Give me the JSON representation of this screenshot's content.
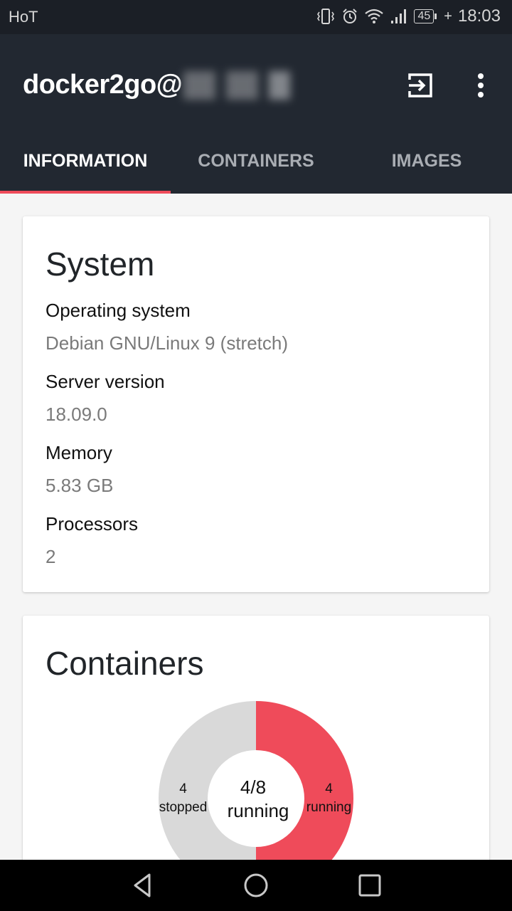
{
  "status_bar": {
    "carrier": "HoT",
    "battery": "45",
    "time": "18:03",
    "icons": [
      "vibrate-icon",
      "alarm-icon",
      "wifi-icon",
      "signal-icon",
      "battery-icon",
      "charging-icon"
    ]
  },
  "app_bar": {
    "title_prefix": "docker2go@",
    "title_host_redacted": true,
    "actions": [
      {
        "name": "logout-icon"
      },
      {
        "name": "more-options-icon"
      }
    ]
  },
  "tabs": [
    {
      "label": "INFORMATION",
      "active": true
    },
    {
      "label": "CONTAINERS",
      "active": false
    },
    {
      "label": "IMAGES",
      "active": false
    }
  ],
  "colors": {
    "accent": "#ef4b5a",
    "appbar": "#222831",
    "statusbar": "#1b1f26",
    "stopped": "#d9d9d9"
  },
  "system": {
    "title": "System",
    "fields": [
      {
        "label": "Operating system",
        "value": "Debian GNU/Linux 9 (stretch)"
      },
      {
        "label": "Server version",
        "value": "18.09.0"
      },
      {
        "label": "Memory",
        "value": "5.83 GB"
      },
      {
        "label": "Processors",
        "value": "2"
      }
    ]
  },
  "containers": {
    "title": "Containers",
    "center_count": "4/8",
    "center_label": "running"
  },
  "chart_data": {
    "type": "pie",
    "title": "Containers",
    "donut": true,
    "center_text": [
      "4/8",
      "running"
    ],
    "slices": [
      {
        "label": "running",
        "value": 4,
        "color": "#ef4b5a",
        "display": [
          "4",
          "running"
        ]
      },
      {
        "label": "stopped",
        "value": 4,
        "color": "#d9d9d9",
        "display": [
          "4",
          "stopped"
        ]
      }
    ]
  },
  "nav_bar": {
    "buttons": [
      "back-icon",
      "home-icon",
      "recents-icon"
    ]
  }
}
